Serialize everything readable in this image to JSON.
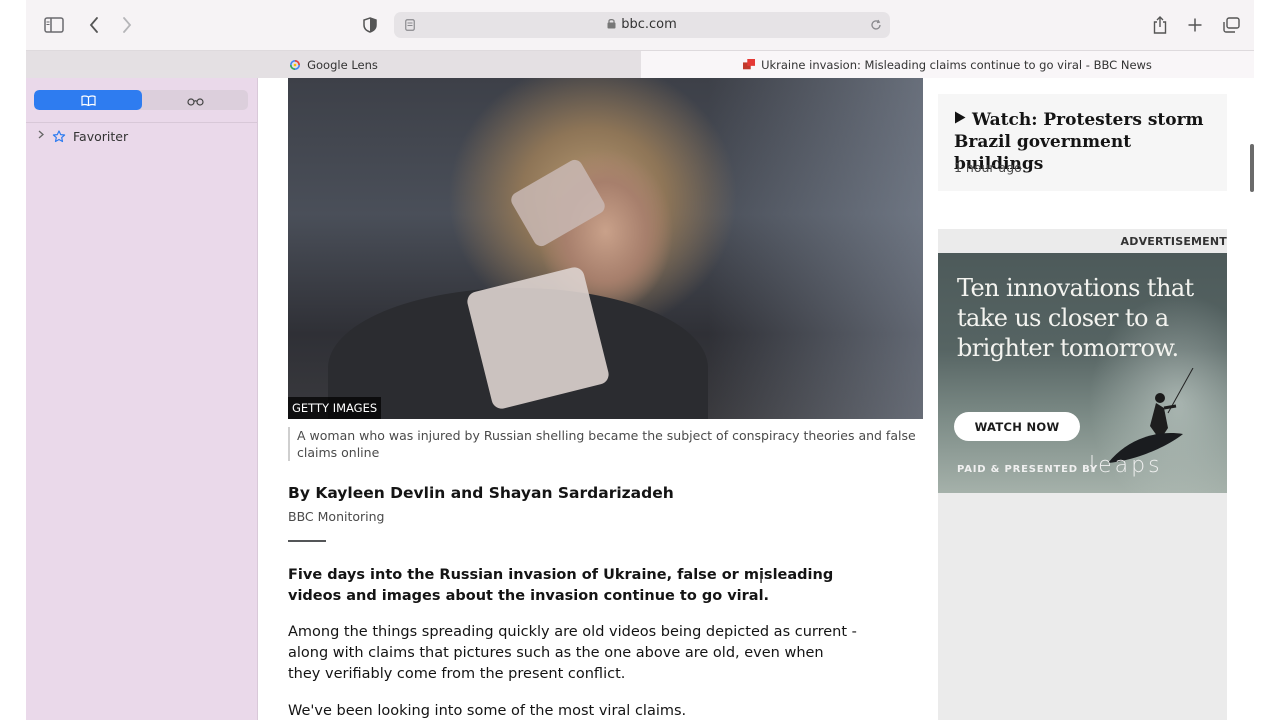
{
  "browser": {
    "url": "bbc.com",
    "tabs": [
      {
        "label": "Google Lens",
        "icon": "google-lens-icon"
      },
      {
        "label": "Ukraine invasion: Misleading claims continue to go viral - BBC News",
        "icon": "bbc-news-icon"
      }
    ]
  },
  "sidebar": {
    "favorites_label": "Favoriter"
  },
  "article": {
    "image_credit": "GETTY IMAGES",
    "caption": "A woman who was injured by Russian shelling became the subject of conspiracy theories and false claims online",
    "byline": "By Kayleen Devlin and Shayan Sardarizadeh",
    "org": "BBC Monitoring",
    "lead": "Five days into the Russian invasion of Ukraine, false or misleading videos and images about the invasion continue to go viral.",
    "paragraph_1": "Among the things spreading quickly are old videos being depicted as current - along with claims that pictures such as the one above are old, even when they verifiably come from the present conflict.",
    "paragraph_2": "We've been looking into some of the most viral claims."
  },
  "related": {
    "title": "Watch: Protesters storm Brazil government buildings",
    "time": "1 hour ago"
  },
  "ad": {
    "label": "ADVERTISEMENT",
    "headline": "Ten innovations that take us closer to a brighter tomorrow.",
    "button": "WATCH NOW",
    "paid": "PAID & PRESENTED BY",
    "brand": "leaps"
  },
  "colors": {
    "accent": "#2e7cf0",
    "sidebar_bg": "#ead9ea",
    "bbc_red": "#d32f2f"
  }
}
